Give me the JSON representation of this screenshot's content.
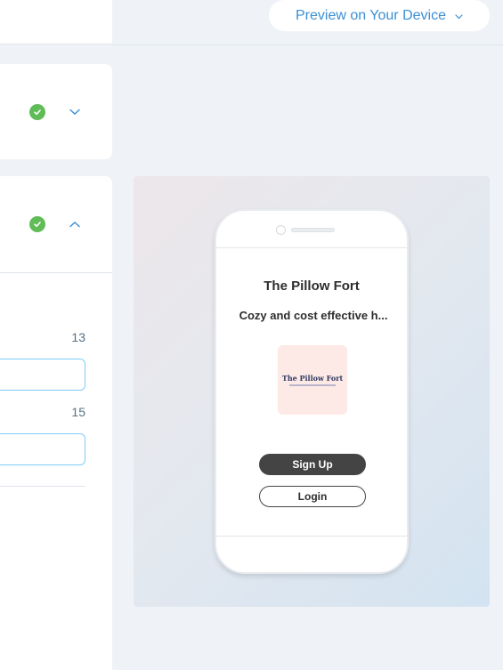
{
  "header": {
    "preview_button_label": "Preview on Your Device",
    "preview_button_icon": "chevron-down-icon"
  },
  "panel": {
    "section1": {
      "status_icon": "check-circle-icon",
      "toggle_icon": "chevron-down-icon"
    },
    "section2": {
      "status_icon": "check-circle-icon",
      "toggle_icon": "chevron-up-icon",
      "field1_counter": "13",
      "field2_counter": "15"
    }
  },
  "preview": {
    "site_title": "The Pillow Fort",
    "site_description": "Cozy and cost effective h...",
    "logo_text": "The Pillow Fort",
    "signup_label": "Sign Up",
    "login_label": "Login"
  },
  "colors": {
    "accent": "#3b8fd5",
    "success": "#60bc57",
    "field_border": "#7fccf7",
    "dark_button": "#444444",
    "logo_bg": "#fde9e5"
  }
}
